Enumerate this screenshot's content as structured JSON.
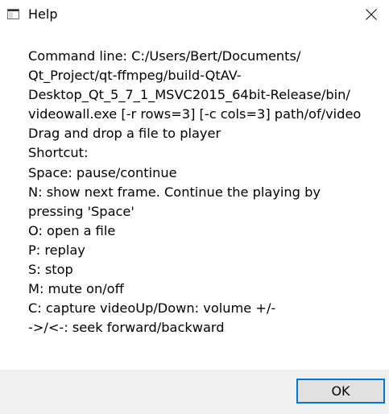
{
  "window": {
    "title": "Help",
    "icon": "application-window-icon",
    "close_icon": "close-icon"
  },
  "content": {
    "lines": [
      "Command line: C:/Users/Bert/Documents/",
      "Qt_Project/qt-ffmpeg/build-QtAV-",
      "Desktop_Qt_5_7_1_MSVC2015_64bit-Release/bin/",
      "videowall.exe [-r rows=3] [-c cols=3] path/of/video",
      "Drag and drop a file to player",
      "Shortcut:",
      "Space: pause/continue",
      "N: show next frame. Continue the playing by",
      "pressing 'Space'",
      "O: open a file",
      "P: replay",
      "S: stop",
      "M: mute on/off",
      "C: capture videoUp/Down: volume +/-",
      "->/<-: seek forward/backward"
    ]
  },
  "footer": {
    "ok_label": "OK"
  },
  "colors": {
    "button_border_focus": "#0078d7",
    "button_face": "#e1e1e1",
    "footer_background": "#f0f0f0"
  }
}
